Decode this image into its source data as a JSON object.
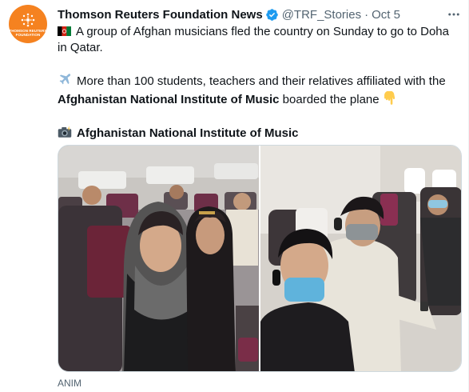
{
  "tweet": {
    "author_name": "Thomson Reuters Foundation News",
    "handle": "@TRF_Stories",
    "separator": "·",
    "date": "Oct 5",
    "avatar_text_line1": "THOMSON REUTERS",
    "avatar_text_line2": "FOUNDATION",
    "line1_text": "A group of Afghan musicians fled the country on Sunday to go to Doha in Qatar.",
    "line2_part1": "More than 100 students, teachers and their relatives affiliated with the ",
    "line2_bold": "Afghanistan National Institute of Music",
    "line2_part2": " boarded the plane",
    "line3_bold": "Afghanistan National Institute of Music",
    "media_caption": "ANIM"
  },
  "icons": {
    "flag": "afghanistan-flag-icon",
    "airplane": "airplane-icon",
    "pointing_down": "backhand-index-pointing-down-icon",
    "camera": "camera-with-flash-icon",
    "verified": "verified-badge-icon",
    "more": "more-options-icon"
  },
  "colors": {
    "avatar_bg": "#f58220",
    "verified": "#1d9bf0",
    "secondary_text": "#536471"
  }
}
